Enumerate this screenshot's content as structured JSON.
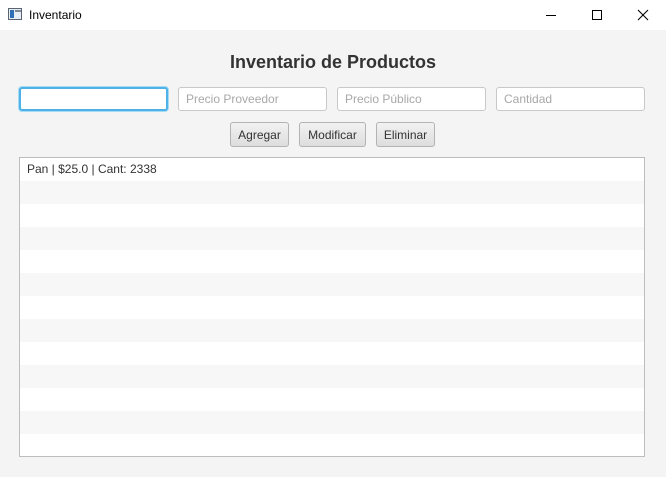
{
  "window": {
    "title": "Inventario"
  },
  "main": {
    "heading": "Inventario de Productos",
    "fields": {
      "nombre": {
        "value": "",
        "placeholder": ""
      },
      "precio_proveedor": {
        "value": "",
        "placeholder": "Precio Proveedor"
      },
      "precio_publico": {
        "value": "",
        "placeholder": "Precio Público"
      },
      "cantidad": {
        "value": "",
        "placeholder": "Cantidad"
      }
    },
    "buttons": {
      "agregar": "Agregar",
      "modificar": "Modificar",
      "eliminar": "Eliminar"
    },
    "list": {
      "items": [
        "Pan | $25.0 | Cant: 2338"
      ]
    }
  },
  "icons": {
    "app": "window-app-icon",
    "minimize": "minimize-icon",
    "maximize": "maximize-icon",
    "close": "close-icon"
  },
  "colors": {
    "focus_border": "#4fb2e6",
    "background": "#f4f4f4"
  }
}
